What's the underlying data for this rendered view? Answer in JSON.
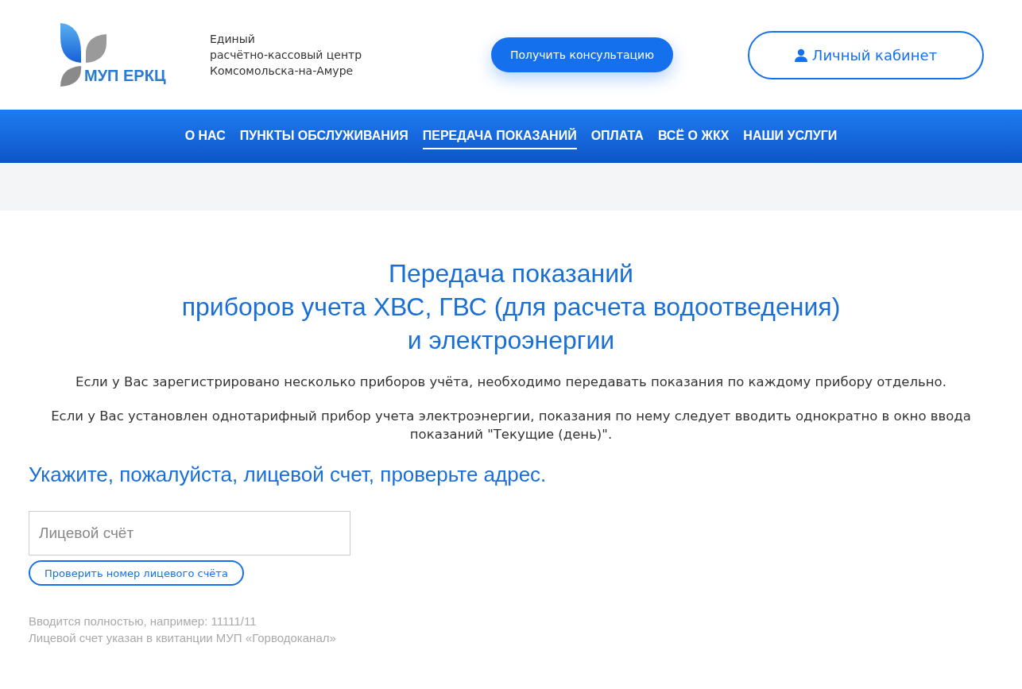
{
  "header": {
    "logo_text": "МУП ЕРКЦ",
    "tagline": [
      "Единый",
      "расчётно-кассовый центр",
      "Комсомольска-на-Амуре"
    ],
    "consult_button": "Получить консультацию",
    "account_button": "Личный кабинет"
  },
  "nav": [
    {
      "label": "О НАС",
      "selected": false
    },
    {
      "label": "ПУНКТЫ ОБСЛУЖИВАНИЯ",
      "selected": false
    },
    {
      "label": "ПЕРЕДАЧА ПОКАЗАНИЙ",
      "selected": true
    },
    {
      "label": "ОПЛАТА",
      "selected": false
    },
    {
      "label": "ВСЁ О ЖКХ",
      "selected": false
    },
    {
      "label": "НАШИ УСЛУГИ",
      "selected": false
    }
  ],
  "title": [
    "Передача показаний",
    "приборов учета ХВС, ГВС (для расчета водоотведения)",
    "и электроэнергии"
  ],
  "notes": [
    "Если у Вас зарегистрировано несколько приборов учёта, необходимо передавать показания по каждому прибору отдельно.",
    "Если у Вас установлен однотарифный прибор учета электроэнергии, показания по нему следует вводить однократно в окно ввода показаний \"Текущие (день)\"."
  ],
  "form": {
    "heading": "Укажите, пожалуйста, лицевой счет, проверьте адрес.",
    "account_field": {
      "placeholder": "Лицевой счёт"
    },
    "check_button": "Проверить номер лицевого счёта",
    "hints": [
      "Вводится полностью, например: 11111/11",
      "Лицевой счет указан в квитанции МУП «Горводоканал»"
    ]
  }
}
